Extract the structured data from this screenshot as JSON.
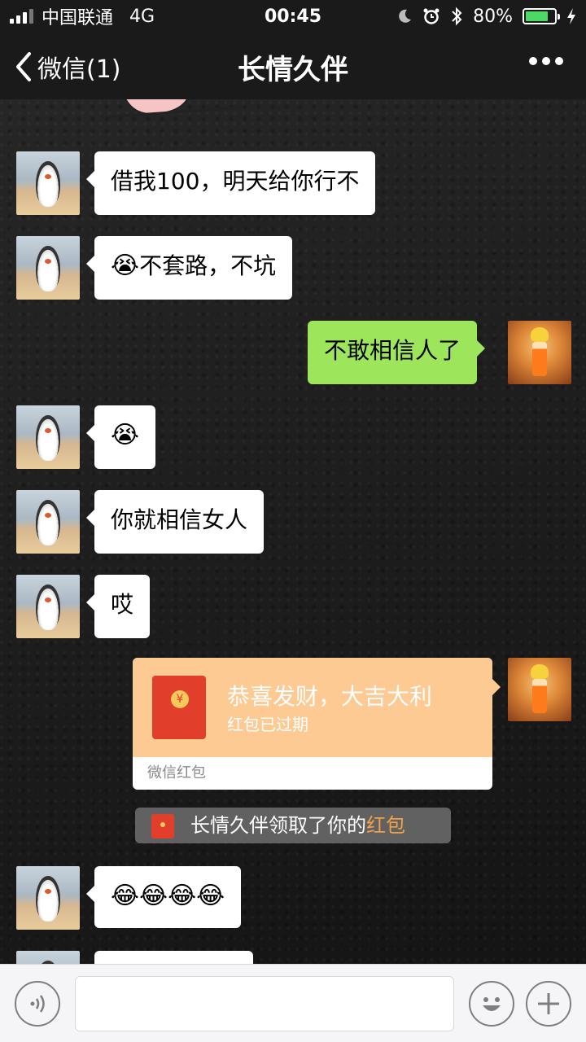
{
  "status_bar": {
    "carrier": "中国联通",
    "network": "4G",
    "time": "00:45",
    "battery": "80%",
    "battery_level": 0.8
  },
  "nav": {
    "back_label": "微信(1)",
    "title": "长情久伴"
  },
  "messages": {
    "m1": "借我100，明天给你行不",
    "m2_emoji": "😭",
    "m2_text": "不套路，不坑",
    "m3": "不敢相信人了",
    "m4_emoji": "😭",
    "m5": "你就相信女人",
    "m6": "哎",
    "m7": "😂😂😂😂"
  },
  "red_packet": {
    "title": "恭喜发财，大吉大利",
    "status": "红包已过期",
    "footer": "微信红包"
  },
  "system_message": {
    "text": "长情久伴领取了你的",
    "link": "红包"
  },
  "colors": {
    "sent_bubble": "#9de65c",
    "red_packet": "#fdca93",
    "link": "#f0a24b"
  }
}
